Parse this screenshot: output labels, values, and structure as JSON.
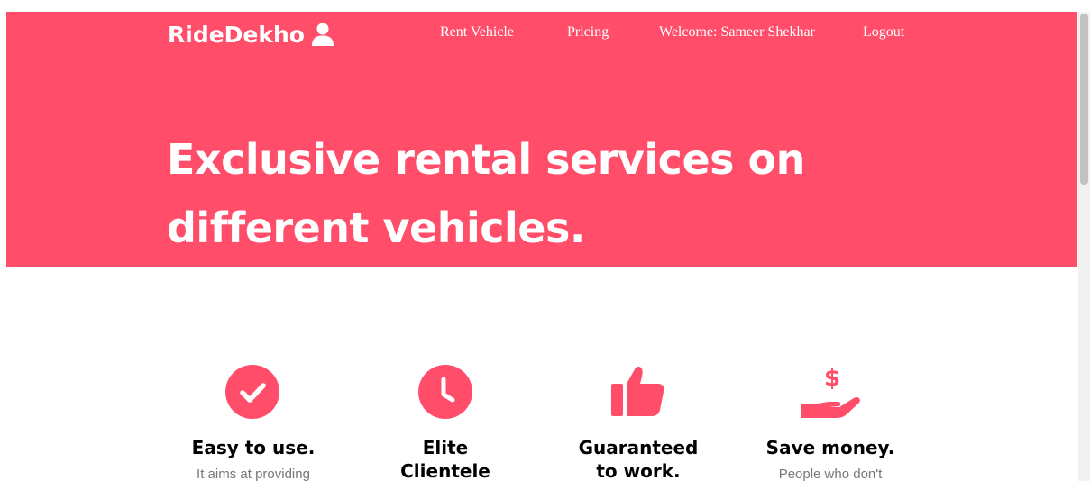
{
  "header": {
    "brand": "RideDekho",
    "brand_icon": "user-icon",
    "nav": [
      {
        "label": "Rent Vehicle"
      },
      {
        "label": "Pricing"
      },
      {
        "label": "Welcome: Sameer Shekhar"
      },
      {
        "label": "Logout"
      }
    ]
  },
  "hero": {
    "line1": "Exclusive rental services on",
    "line2": "different vehicles."
  },
  "features": [
    {
      "icon": "check-circle-icon",
      "title": "Easy to use.",
      "text": "It aims at providing"
    },
    {
      "icon": "clock-icon",
      "title_line1": "Elite",
      "title_line2": "Clientele"
    },
    {
      "icon": "thumbs-up-icon",
      "title_line1": "Guaranteed",
      "title_line2": "to work."
    },
    {
      "icon": "hand-dollar-icon",
      "title": "Save money.",
      "text": "People who don't"
    }
  ],
  "colors": {
    "accent": "#ff4d6a",
    "text": "#000000",
    "muted": "#777777"
  }
}
